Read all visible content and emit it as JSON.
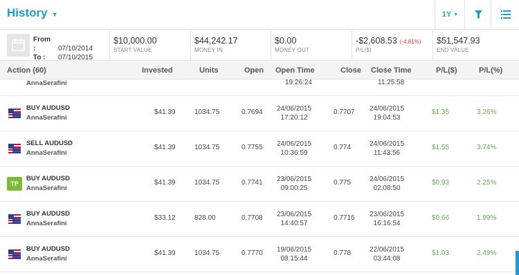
{
  "header": {
    "title": "History",
    "period": "1Y",
    "colors": {
      "accent": "#1a9dd9",
      "positive": "#6aa84f",
      "negative": "#d9342b"
    }
  },
  "summary": {
    "from_label": "From :",
    "from_value": "07/10/2014",
    "to_label": "To :",
    "to_value": "07/10/2015",
    "stats": [
      {
        "value": "$10,000.00",
        "label": "START VALUE",
        "pct": ""
      },
      {
        "value": "$44,242.17",
        "label": "MONEY IN",
        "pct": ""
      },
      {
        "value": "$0.00",
        "label": "MONEY OUT",
        "pct": ""
      },
      {
        "value": "-$2,608.53",
        "label": "P/L($)",
        "pct": "(-4.81%)"
      },
      {
        "value": "$51,547.93",
        "label": "END VALUE",
        "pct": ""
      }
    ]
  },
  "columns": {
    "action": "Action (60)",
    "invested": "Invested",
    "units": "Units",
    "open": "Open",
    "open_time": "Open Time",
    "close": "Close",
    "close_time": "Close Time",
    "pl_usd": "P/L($)",
    "pl_pct": "P/L(%)"
  },
  "partial_row": {
    "name": "AnnaSerafini",
    "open_time": "19:26:24",
    "close_time": "11:25:58"
  },
  "rows": [
    {
      "icon": "us-au-flag-icon",
      "tp": "",
      "action": "BUY AUDUSD",
      "name": "AnnaSerafini",
      "invested": "$41.39",
      "units": "1034.75",
      "open": "0.7694",
      "open_date": "24/06/2015",
      "open_time": "17:20:12",
      "close": "0.7707",
      "close_date": "24/06/2015",
      "close_time": "19:04:53",
      "pl_usd": "$1.35",
      "pl_pct": "3.26%"
    },
    {
      "icon": "us-au-flag-icon",
      "tp": "",
      "action": "SELL AUDUSD",
      "name": "AnnaSerafini",
      "invested": "$41.39",
      "units": "1034.75",
      "open": "0.7755",
      "open_date": "24/06/2015",
      "open_time": "10:36:59",
      "close": "0.774",
      "close_date": "24/06/2015",
      "close_time": "11:43:56",
      "pl_usd": "$1.55",
      "pl_pct": "3.74%"
    },
    {
      "icon": "take-profit-icon",
      "tp": "TP",
      "action": "BUY AUDUSD",
      "name": "AnnaSerafini",
      "invested": "$41.39",
      "units": "1034.75",
      "open": "0.7741",
      "open_date": "23/06/2015",
      "open_time": "09:00:25",
      "close": "0.775",
      "close_date": "24/06/2015",
      "close_time": "02:08:50",
      "pl_usd": "$0.93",
      "pl_pct": "2.25%"
    },
    {
      "icon": "us-au-flag-icon",
      "tp": "",
      "action": "BUY AUDUSD",
      "name": "AnnaSerafini",
      "invested": "$33.12",
      "units": "828.00",
      "open": "0.7708",
      "open_date": "23/06/2015",
      "open_time": "14:40:57",
      "close": "0.7716",
      "close_date": "23/06/2015",
      "close_time": "16:16:54",
      "pl_usd": "$0.66",
      "pl_pct": "1.99%"
    },
    {
      "icon": "us-au-flag-icon",
      "tp": "",
      "action": "BUY AUDUSD",
      "name": "AnnaSerafini",
      "invested": "$41.39",
      "units": "1034.75",
      "open": "0.7770",
      "open_date": "19/06/2015",
      "open_time": "08:15:44",
      "close": "0.778",
      "close_date": "22/06/2015",
      "close_time": "03:44:08",
      "pl_usd": "$1.03",
      "pl_pct": "2.49%"
    }
  ]
}
